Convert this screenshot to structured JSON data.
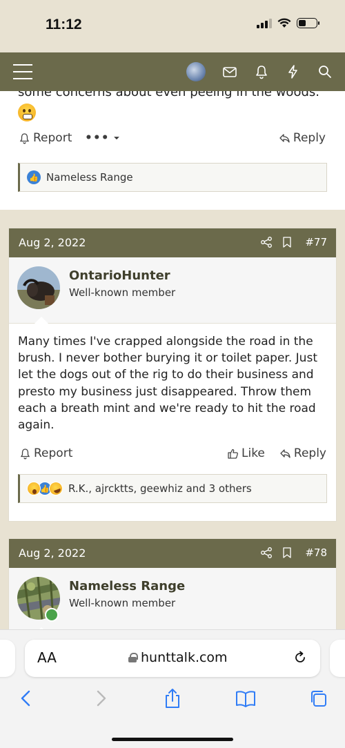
{
  "status_bar": {
    "time": "11:12"
  },
  "nav": {
    "icons": [
      "menu-icon",
      "avatar",
      "envelope-icon",
      "bell-icon",
      "lightning-icon",
      "search-icon"
    ]
  },
  "prev_post": {
    "text_tail": "some concerns about even peeing in the woods.",
    "emoji": "grimacing-face",
    "report_label": "Report",
    "more_label": "•••",
    "reply_label": "Reply",
    "reactions": {
      "text": "Nameless Range",
      "types": [
        "like"
      ]
    }
  },
  "posts": [
    {
      "date": "Aug 2, 2022",
      "number": "#77",
      "author": "OntarioHunter",
      "title": "Well-known member",
      "body": "Many times I've crapped alongside the road in the brush. I never bother burying it or toilet paper. Just let the dogs out of the rig to do their business and presto my business just disappeared. Throw them each a breath mint and we're ready to hit the road again.",
      "report_label": "Report",
      "like_label": "Like",
      "reply_label": "Reply",
      "reactions": {
        "text": "R.K., ajrcktts, geewhiz and 3 others",
        "types": [
          "wow",
          "like",
          "laugh"
        ]
      }
    },
    {
      "date": "Aug 2, 2022",
      "number": "#78",
      "author": "Nameless Range",
      "title": "Well-known member"
    }
  ],
  "safari": {
    "aa_label": "AA",
    "url": "hunttalk.com",
    "toolbar": [
      "back-icon",
      "forward-icon",
      "share-icon",
      "bookmarks-icon",
      "tabs-icon"
    ]
  },
  "colors": {
    "brand": "#6b6a4b",
    "background": "#e8e2d2",
    "like_blue": "#3b82d6",
    "online_green": "#4aa34a"
  }
}
